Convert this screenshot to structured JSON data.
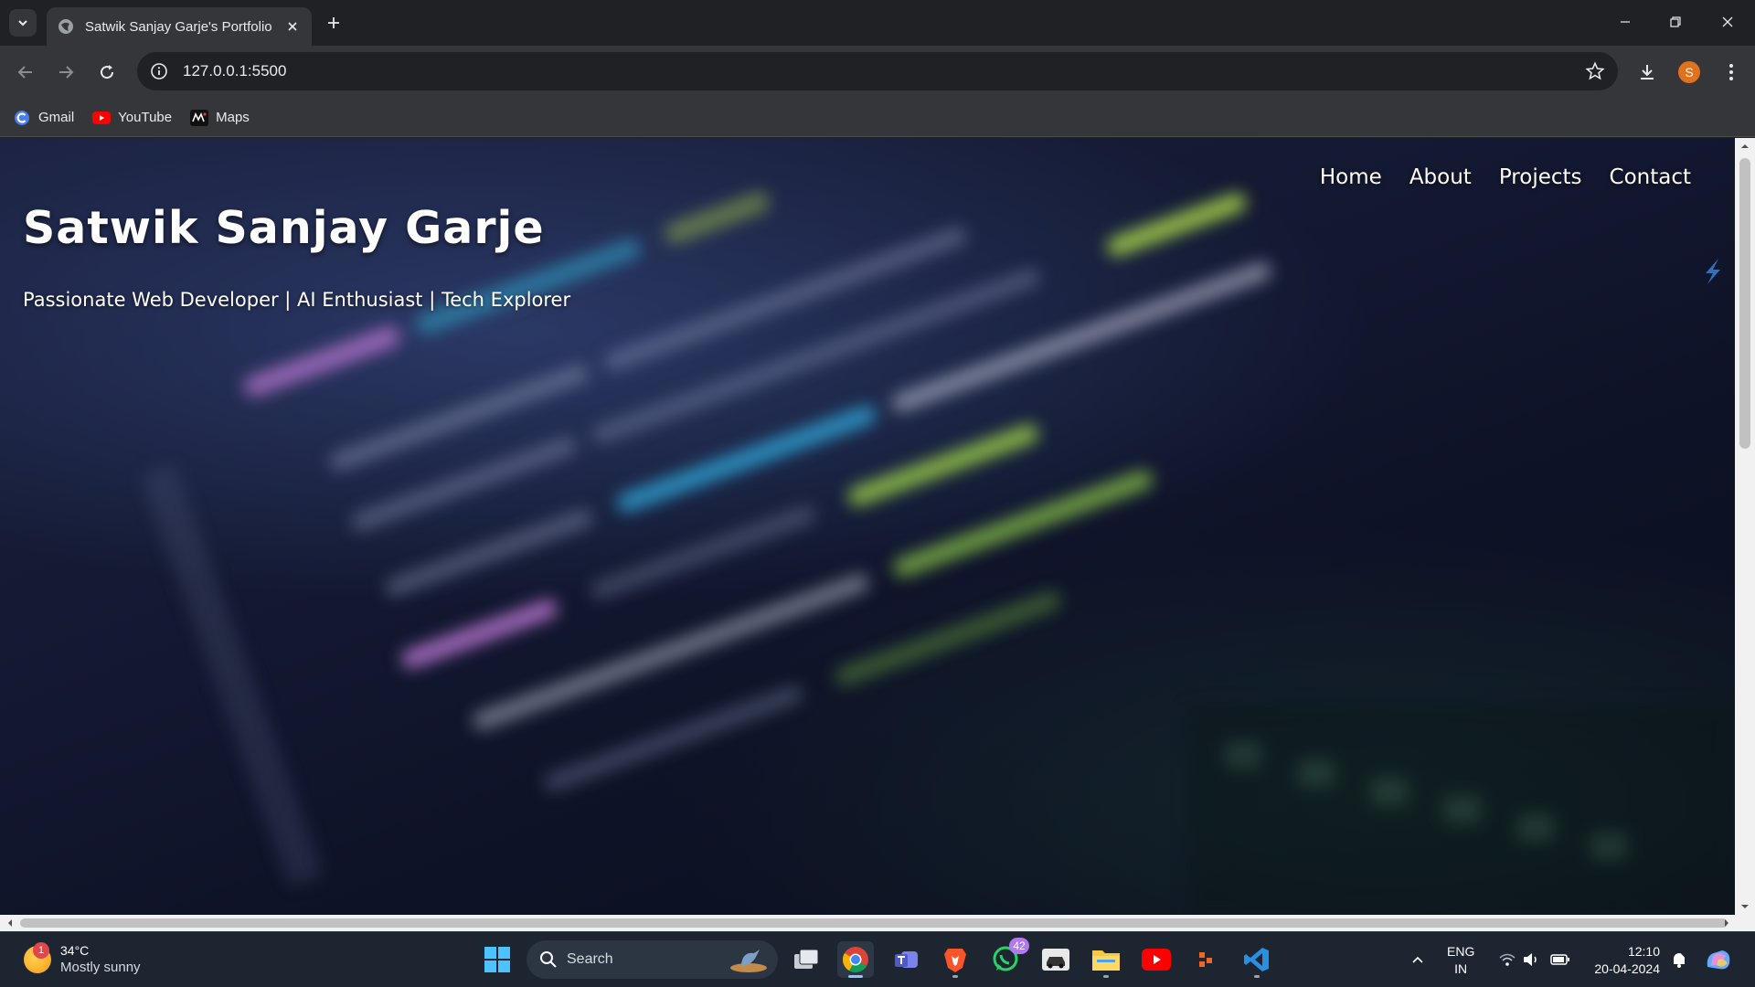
{
  "browser": {
    "tab_title": "Satwik Sanjay Garje's Portfolio",
    "url": "127.0.0.1:5500",
    "profile_initial": "S",
    "bookmarks": [
      {
        "label": "Gmail",
        "icon": "gmail-icon"
      },
      {
        "label": "YouTube",
        "icon": "youtube-icon"
      },
      {
        "label": "Maps",
        "icon": "maps-icon"
      }
    ]
  },
  "site": {
    "title": "Satwik Sanjay Garje",
    "subtitle": "Passionate Web Developer | AI Enthusiast | Tech Explorer",
    "nav": [
      "Home",
      "About",
      "Projects",
      "Contact"
    ]
  },
  "taskbar": {
    "weather_temp": "34°C",
    "weather_desc": "Mostly sunny",
    "weather_badge": "1",
    "search_label": "Search",
    "whatsapp_badge": "42",
    "lang_line1": "ENG",
    "lang_line2": "IN",
    "time": "12:10",
    "date": "20-04-2024"
  },
  "colors": {
    "chrome_dark": "#202124",
    "chrome_toolbar": "#35363a",
    "profile_orange": "#e0711d",
    "taskbar": "#1c2530"
  }
}
